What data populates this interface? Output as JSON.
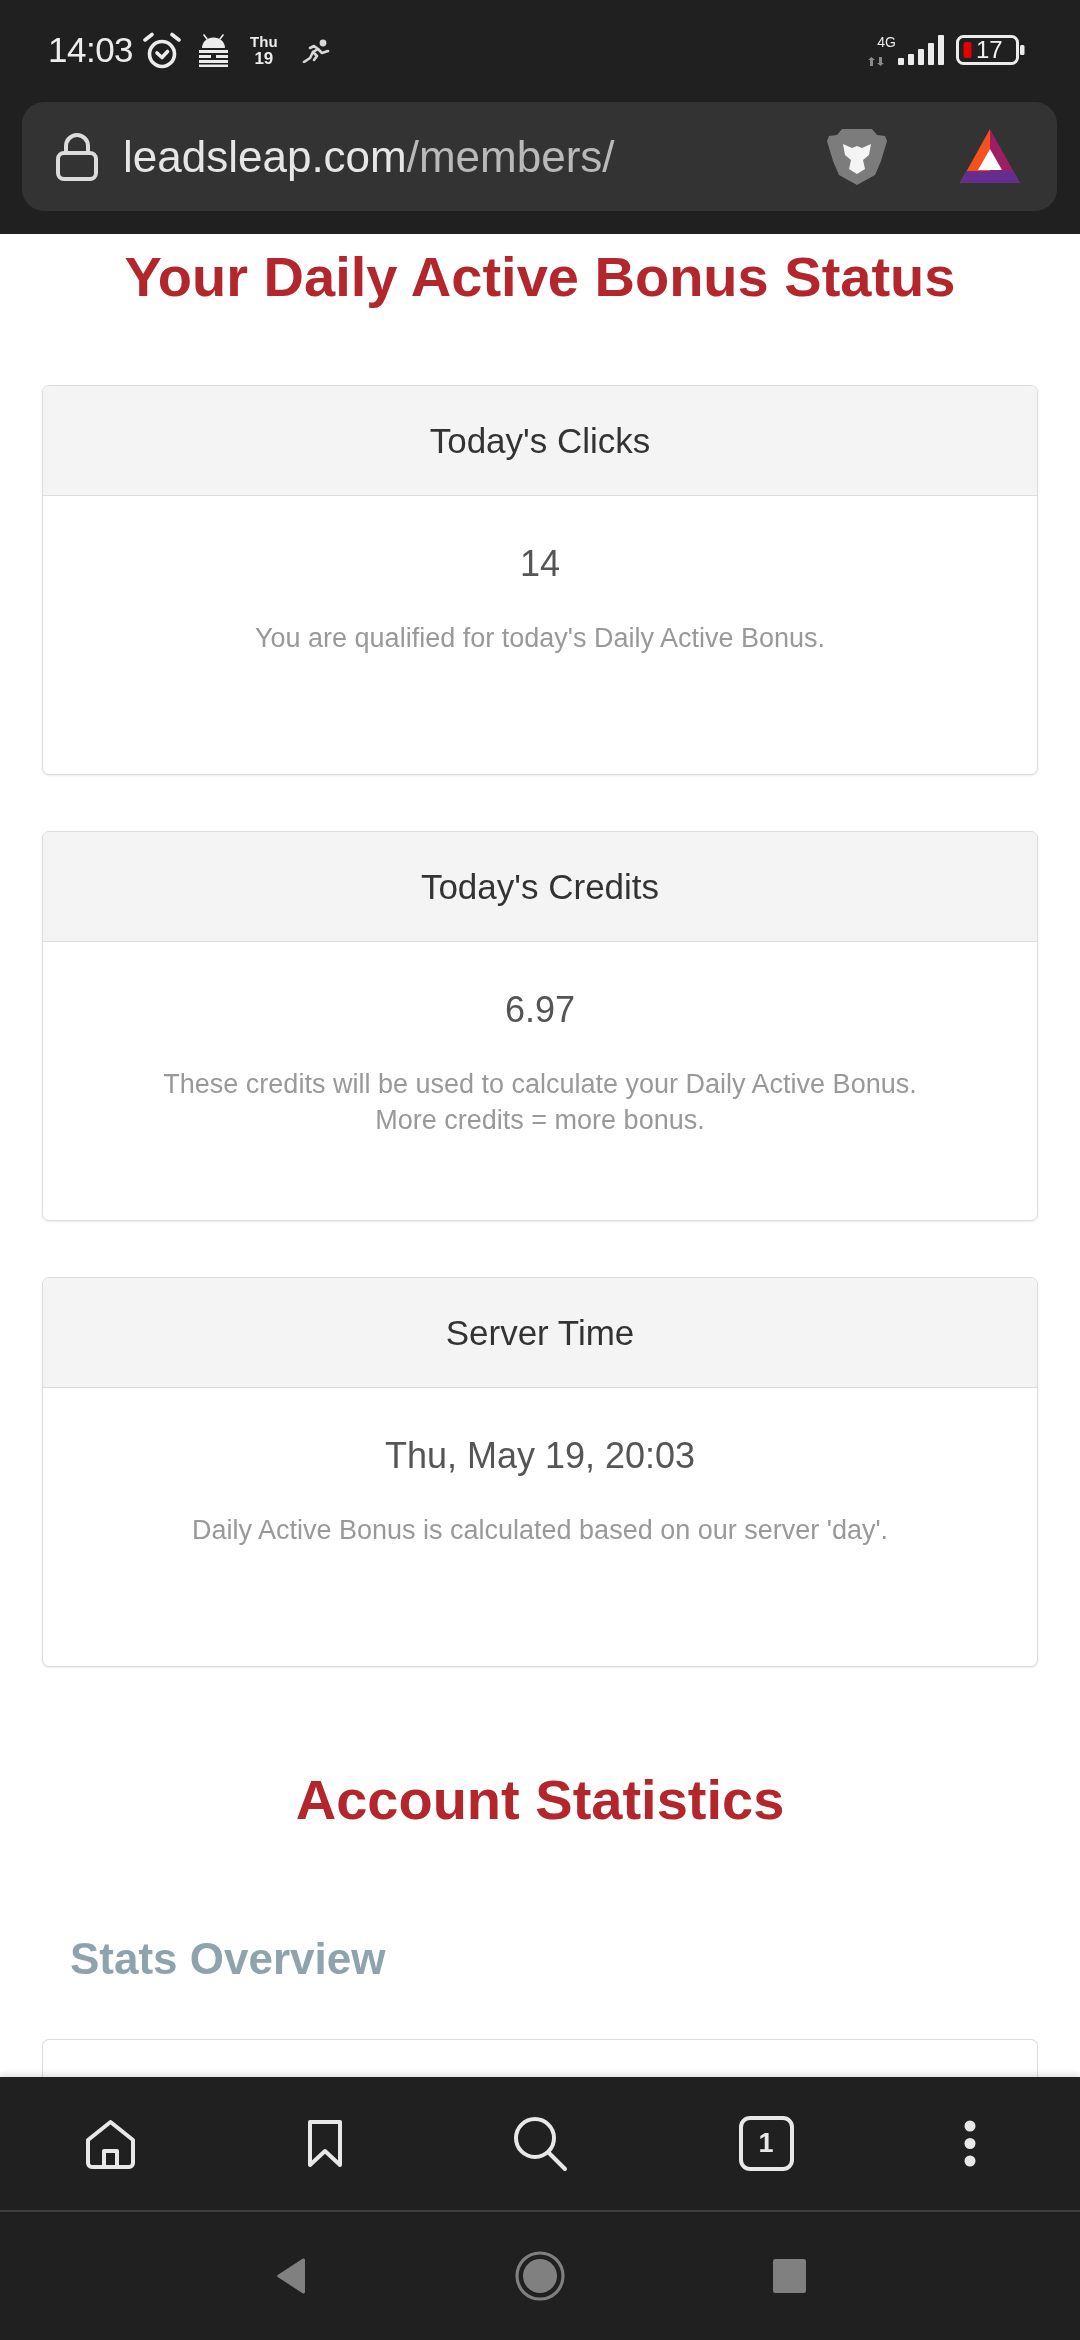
{
  "status_bar": {
    "time": "14:03",
    "weekday": "Thu",
    "day": "19",
    "network": "4G",
    "battery": "17"
  },
  "address_bar": {
    "domain": "leadsleap.com",
    "path": "/members/"
  },
  "page": {
    "title": "Your Daily Active Bonus Status",
    "cards": [
      {
        "header": "Today's Clicks",
        "value": "14",
        "description": "You are qualified for today's Daily Active Bonus."
      },
      {
        "header": "Today's Credits",
        "value": "6.97",
        "description": "These credits will be used to calculate your Daily Active Bonus.\nMore credits = more bonus."
      },
      {
        "header": "Server Time",
        "value": "Thu, May 19, 20:03",
        "description": "Daily Active Bonus is calculated based on our server 'day'."
      }
    ],
    "section_title": "Account Statistics",
    "subsection_title": "Stats Overview"
  },
  "toolbar": {
    "tab_count": "1"
  }
}
